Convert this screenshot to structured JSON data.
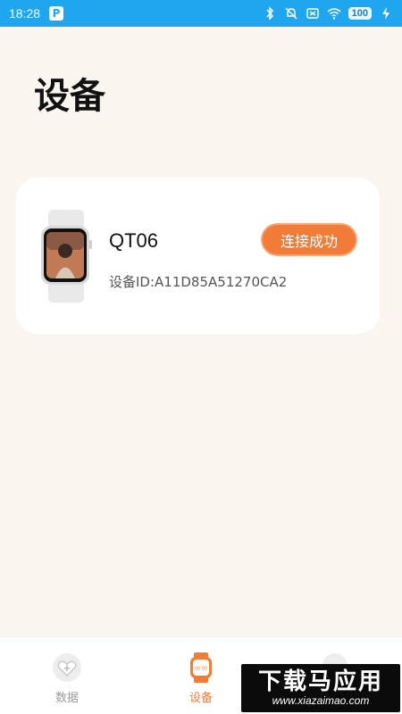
{
  "status_bar": {
    "time": "18:28",
    "app_badge": "P",
    "battery": "100",
    "icons": [
      "bluetooth-icon",
      "mute-icon",
      "sim-off-icon",
      "wifi-icon",
      "charging-icon"
    ]
  },
  "page": {
    "title": "设备"
  },
  "device": {
    "name": "QT06",
    "id_label": "设备ID:A11D85A51270CA2",
    "status": "连接成功",
    "image_icon": "smartwatch-icon"
  },
  "nav": {
    "items": [
      {
        "label": "数据",
        "icon": "heart-plus-icon",
        "active": false
      },
      {
        "label": "设备",
        "icon": "watch-icon",
        "active": true
      }
    ],
    "active_color": "#f07c37",
    "inactive_color": "#9a9a9a"
  },
  "watermark": {
    "main": "下载马应用",
    "sub": "www.xiazaimao.com"
  },
  "colors": {
    "status_bar": "#1fa6ee",
    "background": "#faf5ef",
    "accent": "#f07c37"
  }
}
